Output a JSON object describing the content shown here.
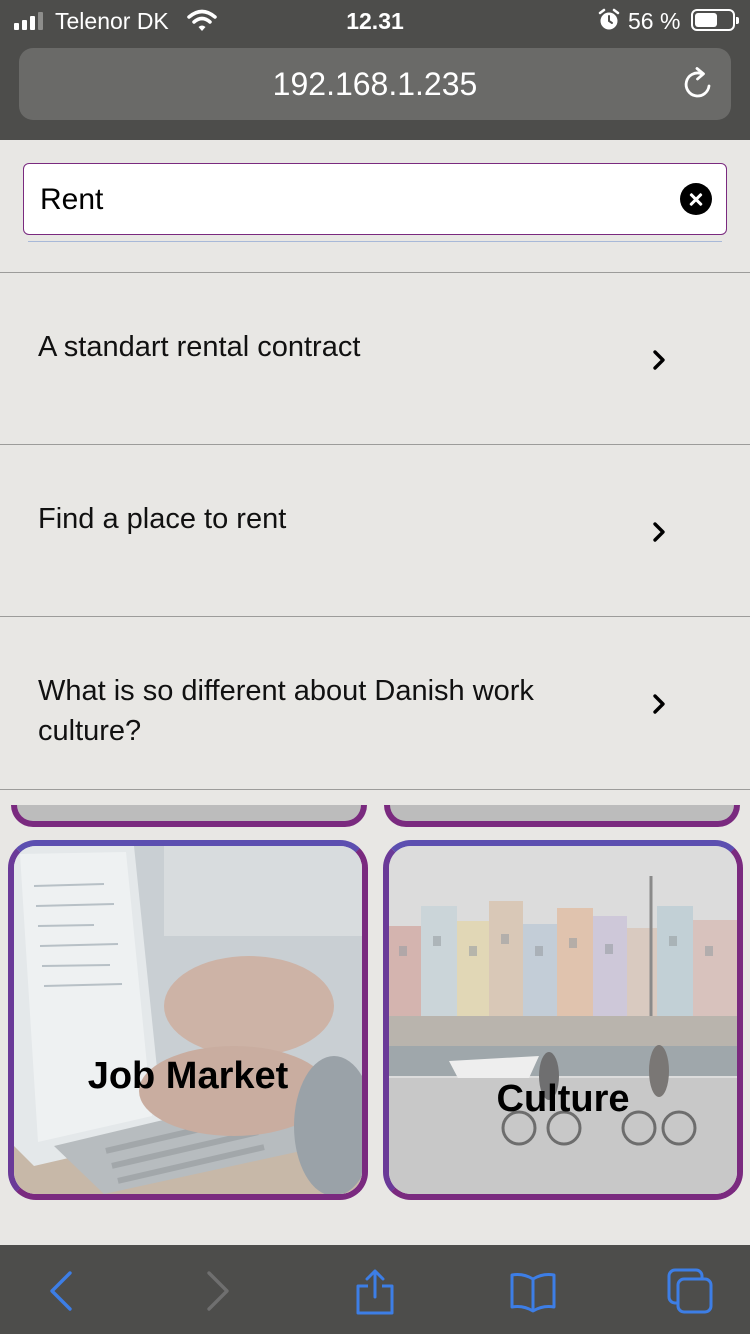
{
  "status": {
    "carrier": "Telenor DK",
    "time": "12.31",
    "battery": "56 %"
  },
  "browser": {
    "url": "192.168.1.235"
  },
  "search": {
    "value": "Rent"
  },
  "results": [
    {
      "text": "A standart rental contract"
    },
    {
      "text": "Find a place to rent"
    },
    {
      "text": "What is so different about Danish work culture?"
    }
  ],
  "cards": [
    {
      "label": "Job Market"
    },
    {
      "label": "Culture"
    }
  ],
  "colors": {
    "accent": "#7a2a7f",
    "ios_blue": "#3d7ee6",
    "chrome": "#4d4d4b",
    "background": "#e8e7e4"
  },
  "icons": [
    "wifi-icon",
    "alarm-icon",
    "battery-icon",
    "reload-icon",
    "clear-icon",
    "chevron-right-icon",
    "back-icon",
    "forward-icon",
    "share-icon",
    "bookmarks-icon",
    "tabs-icon"
  ]
}
